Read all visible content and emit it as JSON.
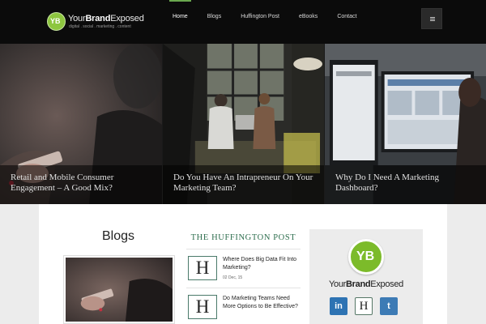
{
  "brand": {
    "name_prefix": "Your",
    "name_bold": "Brand",
    "name_suffix": "Exposed",
    "tagline": "digital . social . marketing . content",
    "badge_text": "YB"
  },
  "nav": {
    "items": [
      {
        "label": "Home",
        "active": true
      },
      {
        "label": "Blogs",
        "active": false
      },
      {
        "label": "Huffington Post",
        "active": false
      },
      {
        "label": "eBooks",
        "active": false
      },
      {
        "label": "Contact",
        "active": false
      }
    ],
    "menu_icon": "hamburger-icon"
  },
  "featured": [
    {
      "title": "Retail and Mobile Consumer Engagement – A Good Mix?"
    },
    {
      "title": "Do You Have An Intrapreneur On Your Marketing Team?"
    },
    {
      "title": "Why Do I Need A Marketing Dashboard?"
    }
  ],
  "blogs": {
    "heading": "Blogs"
  },
  "huffington": {
    "logo_text": "THE HUFFINGTON POST",
    "icon_letter": "H",
    "items": [
      {
        "title": "Where Does Big Data Fit Into Marketing?",
        "date": "02 Dec, 15"
      },
      {
        "title": "Do Marketing Teams Need More Options to Be Effective?",
        "date": ""
      }
    ]
  },
  "sidebar": {
    "badge_text": "YB",
    "brand_prefix": "Your",
    "brand_bold": "Brand",
    "brand_suffix": "Exposed",
    "social": [
      {
        "label": "in",
        "icon": "linkedin-icon"
      },
      {
        "label": "H",
        "icon": "huffington-icon"
      },
      {
        "label": "t",
        "icon": "twitter-icon"
      }
    ]
  },
  "colors": {
    "header_bg": "#0b0b0b",
    "accent_green": "#6aa84f",
    "huffpost_green": "#2e6e4e",
    "page_bg": "#ececec"
  }
}
